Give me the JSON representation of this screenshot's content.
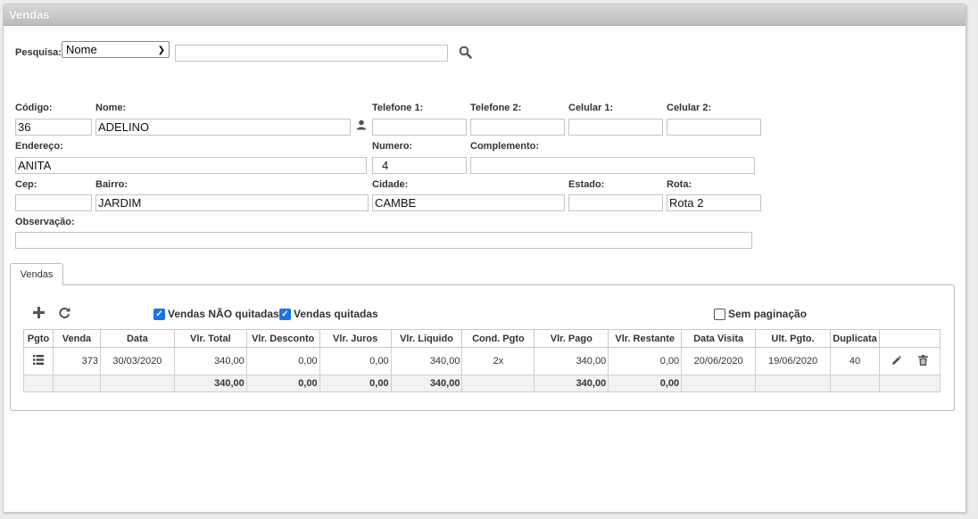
{
  "title": "Vendas",
  "search": {
    "label": "Pesquisa:",
    "select_value": "Nome",
    "value": ""
  },
  "fields": {
    "codigo": {
      "label": "Código:",
      "value": "36"
    },
    "nome": {
      "label": "Nome:",
      "value": "ADELINO"
    },
    "telefone1": {
      "label": "Telefone 1:",
      "value": ""
    },
    "telefone2": {
      "label": "Telefone 2:",
      "value": ""
    },
    "celular1": {
      "label": "Celular 1:",
      "value": ""
    },
    "celular2": {
      "label": "Celular 2:",
      "value": ""
    },
    "endereco": {
      "label": "Endereço:",
      "value": "ANITA"
    },
    "numero": {
      "label": "Numero:",
      "value": "4"
    },
    "complemento": {
      "label": "Complemento:",
      "value": ""
    },
    "cep": {
      "label": "Cep:",
      "value": ""
    },
    "bairro": {
      "label": "Bairro:",
      "value": "JARDIM"
    },
    "cidade": {
      "label": "Cidade:",
      "value": "CAMBE"
    },
    "estado": {
      "label": "Estado:",
      "value": ""
    },
    "rota": {
      "label": "Rota:",
      "value": "Rota 2"
    },
    "observacao": {
      "label": "Observação:",
      "value": ""
    }
  },
  "tab": {
    "label": "Vendas"
  },
  "toolbar": {
    "nao_quitadas": {
      "label": "Vendas NÃO quitadas",
      "checked": true
    },
    "quitadas": {
      "label": "Vendas quitadas",
      "checked": true
    },
    "sem_paginacao": {
      "label": "Sem paginação",
      "checked": false
    }
  },
  "table": {
    "columns": [
      "Pgto",
      "Venda",
      "Data",
      "Vlr. Total",
      "Vlr. Desconto",
      "Vlr. Juros",
      "Vlr. Liquido",
      "Cond. Pgto",
      "Vlr. Pago",
      "Vlr. Restante",
      "Data Visita",
      "Ult. Pgto.",
      "Duplicata"
    ],
    "rows": [
      {
        "venda": "373",
        "data": "30/03/2020",
        "total": "340,00",
        "desconto": "0,00",
        "juros": "0,00",
        "liquido": "340,00",
        "cond": "2x",
        "pago": "340,00",
        "restante": "0,00",
        "visita": "20/06/2020",
        "ult": "19/06/2020",
        "duplicata": "40"
      }
    ],
    "totals": {
      "total": "340,00",
      "desconto": "0,00",
      "juros": "0,00",
      "liquido": "340,00",
      "pago": "340,00",
      "restante": "0,00"
    }
  }
}
